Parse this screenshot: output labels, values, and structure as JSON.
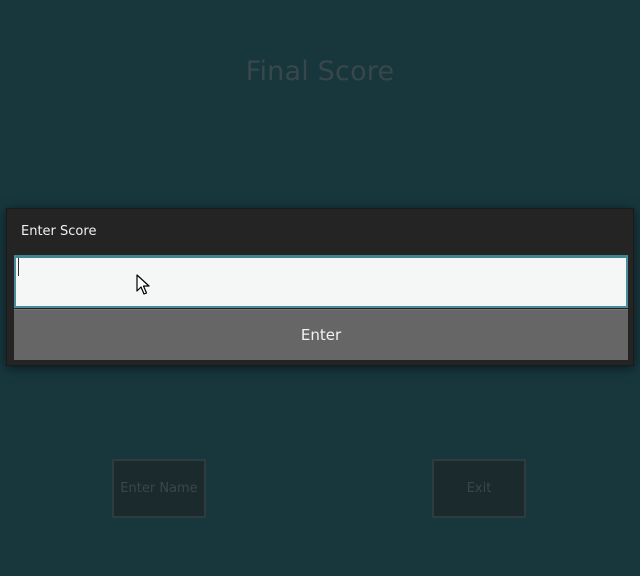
{
  "background": {
    "title": "Final Score",
    "buttons": {
      "enter_name": "Enter Name",
      "exit": "Exit"
    }
  },
  "dialog": {
    "title": "Enter Score",
    "input": {
      "value": "",
      "placeholder": ""
    },
    "enter_label": "Enter"
  },
  "colors": {
    "background": "#17373d",
    "dialog": "#242424",
    "input_border": "#4a8c99",
    "enter_button": "#666666"
  },
  "icons": {
    "cursor": "mouse-pointer-arrow"
  }
}
